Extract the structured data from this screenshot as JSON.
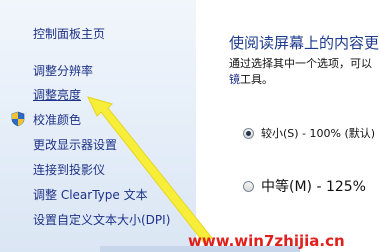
{
  "sidebar": {
    "home": "控制面板主页",
    "items": [
      {
        "label": "调整分辨率"
      },
      {
        "label": "调整亮度"
      },
      {
        "label": "校准颜色"
      },
      {
        "label": "更改显示器设置"
      },
      {
        "label": "连接到投影仪"
      },
      {
        "label": "调整 ClearType 文本"
      },
      {
        "label": "设置自定义文本大小(DPI)"
      }
    ]
  },
  "content": {
    "heading": "使阅读屏幕上的内容更",
    "description_line1": "通过选择其中一个选项，可以",
    "description_line2_link": "镜",
    "description_line2_rest": "工具。",
    "options": [
      {
        "label": "较小(S) - 100% (默认)",
        "checked": true
      },
      {
        "label": "中等(M) - 125%",
        "checked": false
      }
    ]
  },
  "watermark": "www.win7zhijia.cn",
  "colors": {
    "link": "#1e3287",
    "heading": "#1e3b8c",
    "arrow": "#f7ee3a",
    "watermark": "#e0201c"
  }
}
